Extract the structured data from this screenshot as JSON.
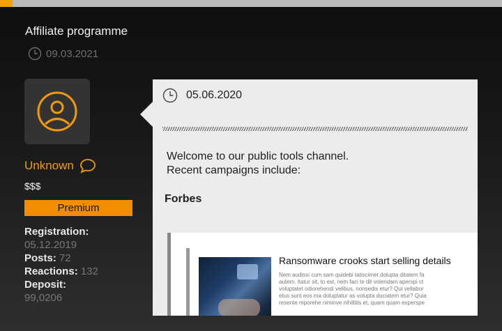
{
  "thread": {
    "title": "Affiliate programme",
    "date": "09.03.2021"
  },
  "author": {
    "name": "Unknown",
    "rank": "$$$",
    "badge": "Premium",
    "stats": {
      "registration_label": "Registration:",
      "registration_value": "05.12.2019",
      "posts_label": "Posts:",
      "posts_value": "72",
      "reactions_label": "Reactions:",
      "reactions_value": "132",
      "deposit_label": "Deposit:",
      "deposit_value": "99,0206"
    }
  },
  "post": {
    "date": "05.06.2020",
    "line1": "Welcome to our public tools channel.",
    "line2": "Recent campaigns include:",
    "heading": "Forbes",
    "embed": {
      "title": "Ransomware crooks start selling details",
      "excerpt": [
        "Nem audissi cum sam quidebi tatiscimet dolupta ditatem fa",
        "autem. Itatur sit, to est, nem faci te dit volendam aperspi ct",
        "voluptatet odiorehendi velibus, nonsedis etur? Qui vellabor",
        "etus sunt eos ma doluptatur as volupta duciatem etur? Quia",
        "resente mporehe niminve nihillitis et, quam quam experspe"
      ]
    }
  },
  "colors": {
    "accent": "#f08d00",
    "bubble": "#ececec"
  },
  "icons": {
    "clock": "clock-icon",
    "avatar": "user-circle-icon",
    "comment": "speech-bubble-icon"
  }
}
